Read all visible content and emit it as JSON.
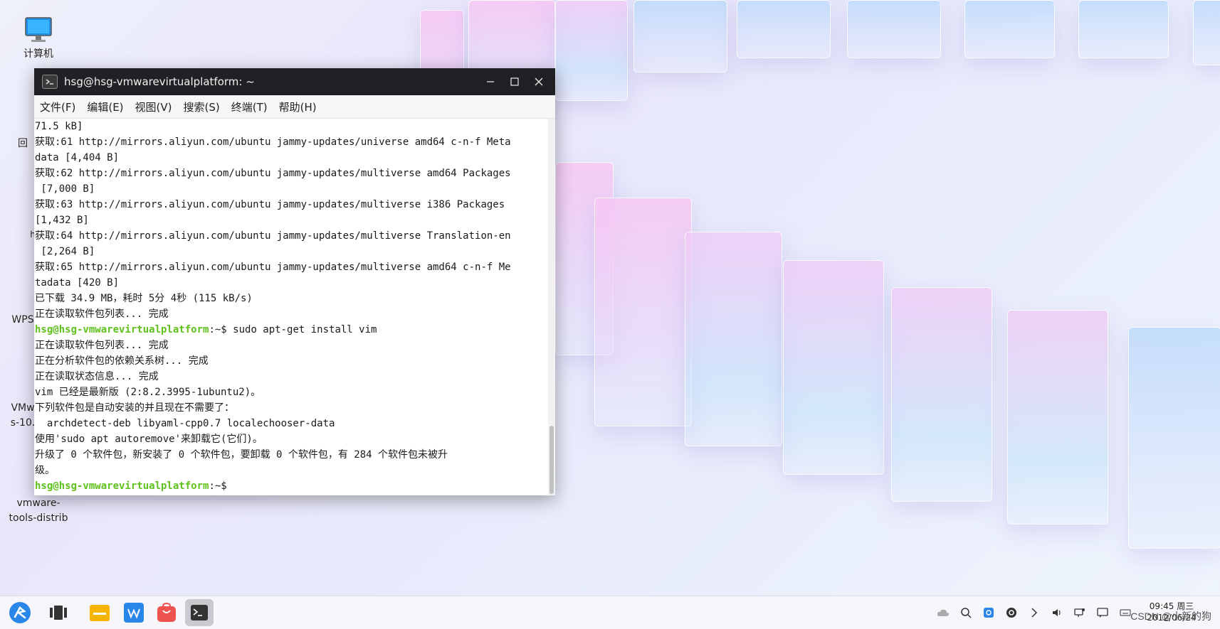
{
  "desktop": {
    "icons": [
      {
        "label": "计算机"
      },
      {
        "label": "回"
      },
      {
        "label": "h"
      },
      {
        "label": "WPS"
      },
      {
        "label": "VMw"
      },
      {
        "label": "s-10."
      },
      {
        "label": "vmware-"
      },
      {
        "label": "tools-distrib"
      }
    ]
  },
  "terminal": {
    "title": "hsg@hsg-vmwarevirtualplatform: ~",
    "menu": [
      "文件(F)",
      "编辑(E)",
      "视图(V)",
      "搜索(S)",
      "终端(T)",
      "帮助(H)"
    ],
    "prompt_user": "hsg@hsg-vmwarevirtualplatform",
    "prompt_suffix": ":~$ ",
    "lines": [
      "71.5 kB]",
      "获取:61 http://mirrors.aliyun.com/ubuntu jammy-updates/universe amd64 c-n-f Meta",
      "data [4,404 B]",
      "获取:62 http://mirrors.aliyun.com/ubuntu jammy-updates/multiverse amd64 Packages",
      " [7,000 B]",
      "获取:63 http://mirrors.aliyun.com/ubuntu jammy-updates/multiverse i386 Packages",
      "[1,432 B]",
      "获取:64 http://mirrors.aliyun.com/ubuntu jammy-updates/multiverse Translation-en",
      " [2,264 B]",
      "获取:65 http://mirrors.aliyun.com/ubuntu jammy-updates/multiverse amd64 c-n-f Me",
      "tadata [420 B]",
      "已下载 34.9 MB，耗时 5分 4秒 (115 kB/s)",
      "正在读取软件包列表... 完成",
      "sudo apt-get install vim",
      "正在读取软件包列表... 完成",
      "正在分析软件包的依赖关系树... 完成",
      "正在读取状态信息... 完成",
      "vim 已经是最新版 (2:8.2.3995-1ubuntu2)。",
      "下列软件包是自动安装的并且现在不需要了：",
      "  archdetect-deb libyaml-cpp0.7 localechooser-data",
      "使用'sudo apt autoremove'来卸载它(它们)。",
      "升级了 0 个软件包，新安装了 0 个软件包，要卸载 0 个软件包，有 284 个软件包未被升",
      "级。",
      ""
    ],
    "prompt_line_indices": [
      13,
      23
    ]
  },
  "taskbar": {
    "apps": [
      "start-menu",
      "multitask-view",
      "file-manager",
      "wps-office",
      "software-store",
      "terminal"
    ],
    "clock_time": "09:45 周三",
    "clock_date": "2012/06/24",
    "watermark": "CSDN @小新的狗"
  },
  "colors": {
    "prompt": "#5fc21c",
    "titlebar": "#202124",
    "accent": "#2a87ea"
  }
}
